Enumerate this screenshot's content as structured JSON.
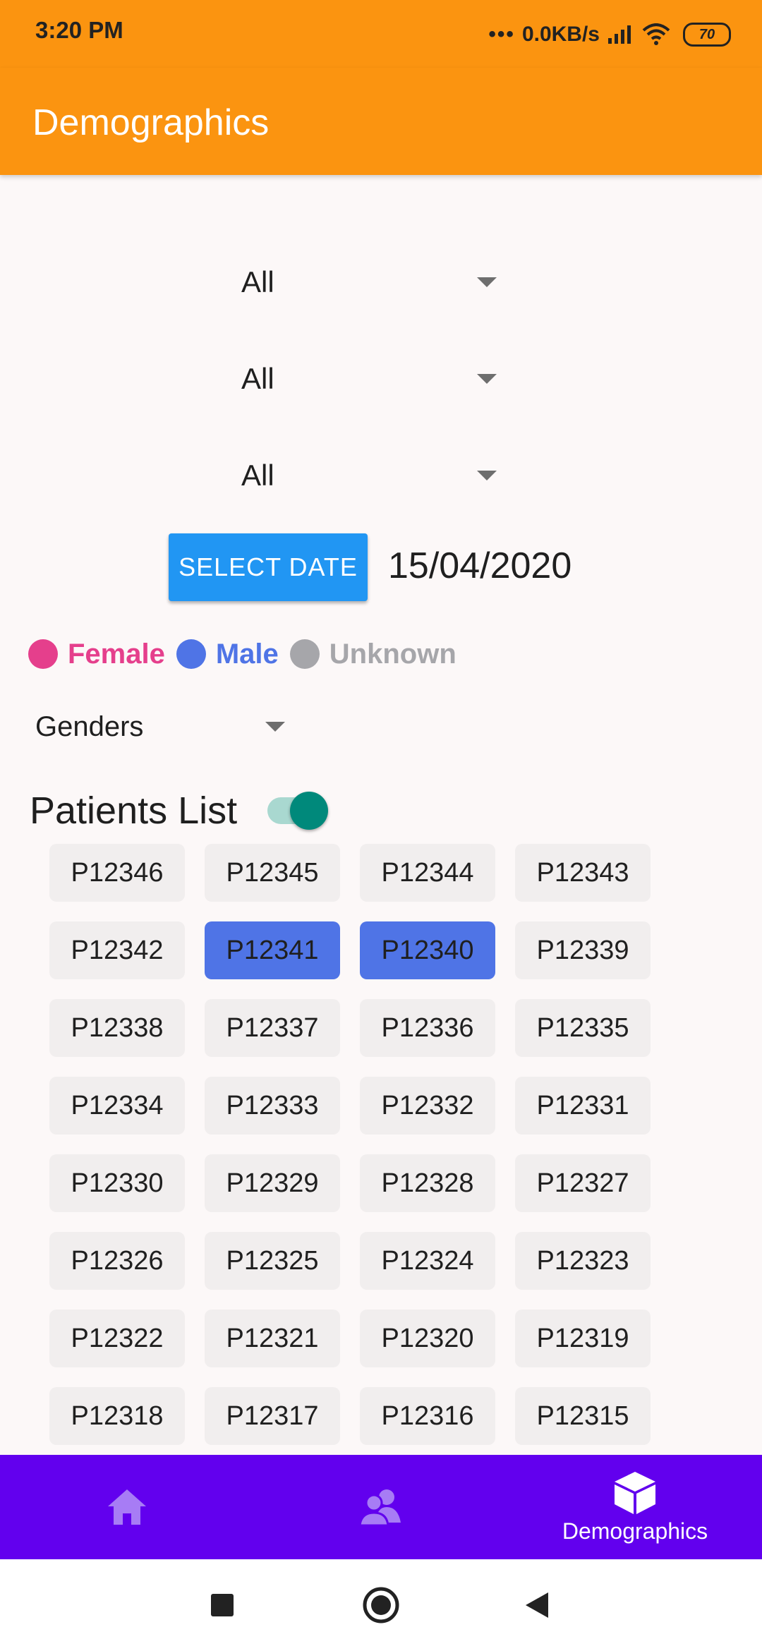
{
  "status_bar": {
    "time": "3:20 PM",
    "network_speed": "0.0KB/s",
    "battery": "70"
  },
  "app_bar": {
    "title": "Demographics"
  },
  "filters": [
    {
      "value": "All"
    },
    {
      "value": "All"
    },
    {
      "value": "All"
    }
  ],
  "date_picker": {
    "button_label": "SELECT DATE",
    "value": "15/04/2020"
  },
  "legend": [
    {
      "label": "Female",
      "color": "#e53f8c"
    },
    {
      "label": "Male",
      "color": "#4f74e6"
    },
    {
      "label": "Unknown",
      "color": "#a6a6aa"
    }
  ],
  "gender_filter": {
    "value": "Genders"
  },
  "patients": {
    "title": "Patients List",
    "toggle_on": true,
    "ids": [
      "P12346",
      "P12345",
      "P12344",
      "P12343",
      "P12342",
      "P12341",
      "P12340",
      "P12339",
      "P12338",
      "P12337",
      "P12336",
      "P12335",
      "P12334",
      "P12333",
      "P12332",
      "P12331",
      "P12330",
      "P12329",
      "P12328",
      "P12327",
      "P12326",
      "P12325",
      "P12324",
      "P12323",
      "P12322",
      "P12321",
      "P12320",
      "P12319",
      "P12318",
      "P12317",
      "P12316",
      "P12315"
    ],
    "selected": [
      "P12341",
      "P12340"
    ]
  },
  "bottom_nav": {
    "items": [
      {
        "icon": "home-icon",
        "label": ""
      },
      {
        "icon": "people-icon",
        "label": ""
      },
      {
        "icon": "cube-icon",
        "label": "Demographics",
        "active": true
      }
    ],
    "inactive_color": "#a77cf5",
    "active_color": "#ffffff"
  },
  "system_nav": [
    "recents-icon",
    "home-circle-icon",
    "back-icon"
  ]
}
